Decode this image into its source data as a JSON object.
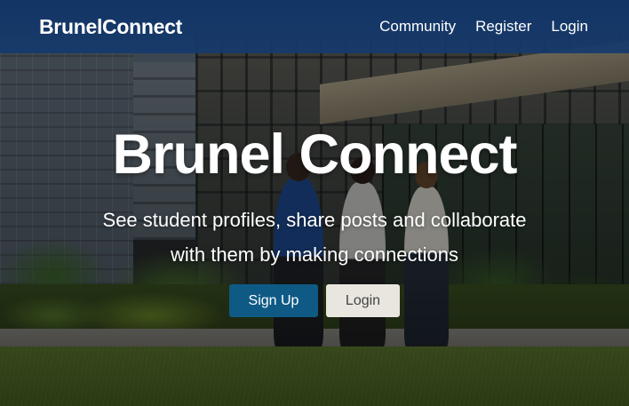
{
  "navbar": {
    "brand": "BrunelConnect",
    "links": [
      {
        "label": "Community"
      },
      {
        "label": "Register"
      },
      {
        "label": "Login"
      }
    ]
  },
  "hero": {
    "title": "Brunel Connect",
    "subtitle_line1": "See student profiles, share posts and collaborate",
    "subtitle_line2": "with them by making connections",
    "signup_label": "Sign Up",
    "login_label": "Login"
  },
  "colors": {
    "navbar_bg": "#123a6c",
    "primary_button": "#0f5a85",
    "light_button": "#e9e6e0",
    "text": "#ffffff"
  }
}
